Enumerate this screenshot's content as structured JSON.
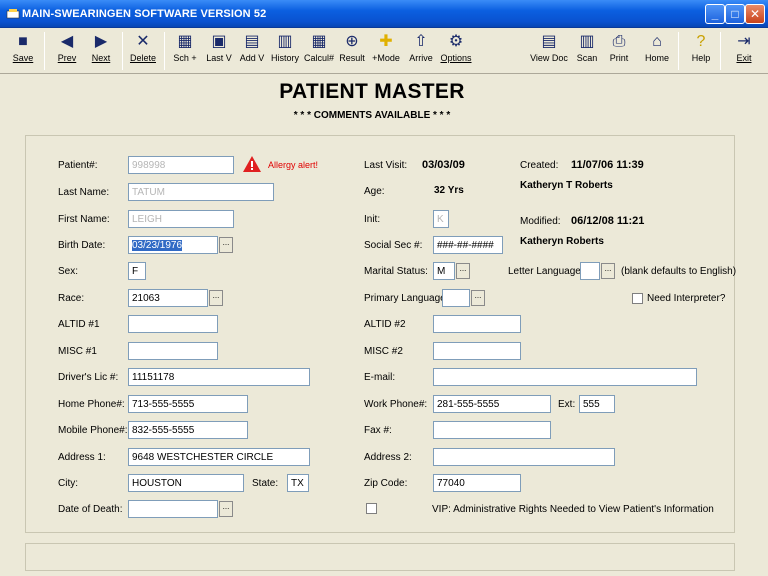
{
  "window": {
    "title": "MAIN-SWEARINGEN SOFTWARE VERSION 52",
    "minimize": "_",
    "maximize": "□",
    "close": "✕"
  },
  "toolbar": {
    "buttons": [
      {
        "label": "Save",
        "icon": "save-icon",
        "glyph": "■"
      },
      {
        "label": "Prev",
        "icon": "prev-icon",
        "glyph": "◀"
      },
      {
        "label": "Next",
        "icon": "next-icon",
        "glyph": "▶"
      },
      {
        "label": "Delete",
        "icon": "delete-icon",
        "glyph": "✕"
      },
      {
        "label": "Sch +",
        "icon": "schedule-icon",
        "glyph": "▦"
      },
      {
        "label": "Last V",
        "icon": "last-visit-icon",
        "glyph": "▣"
      },
      {
        "label": "Add V",
        "icon": "add-visit-icon",
        "glyph": "▤"
      },
      {
        "label": "History",
        "icon": "history-icon",
        "glyph": "▥"
      },
      {
        "label": "Calcul#",
        "icon": "calculator-icon",
        "glyph": "▦"
      },
      {
        "label": "Result",
        "icon": "result-icon",
        "glyph": "⊕"
      },
      {
        "label": "+Mode",
        "icon": "plus-mode-icon",
        "glyph": "✚"
      },
      {
        "label": "Arrive",
        "icon": "arrive-icon",
        "glyph": "⇧"
      },
      {
        "label": "Options",
        "icon": "options-icon",
        "glyph": "⚙"
      },
      {
        "label": "View Doc",
        "icon": "view-doc-icon",
        "glyph": "▤"
      },
      {
        "label": "Scan",
        "icon": "scan-icon",
        "glyph": "▥"
      },
      {
        "label": "Print",
        "icon": "print-icon",
        "glyph": "⎙"
      },
      {
        "label": "Home",
        "icon": "home-icon",
        "glyph": "⌂"
      },
      {
        "label": "Help",
        "icon": "help-icon",
        "glyph": "?"
      },
      {
        "label": "Exit",
        "icon": "exit-icon",
        "glyph": "⇥"
      }
    ]
  },
  "header": {
    "title": "PATIENT MASTER",
    "subtitle": "* * * COMMENTS AVAILABLE * * *"
  },
  "alert": {
    "text": "Allergy alert!",
    "color": "#e00000"
  },
  "form": {
    "patient_num": {
      "label": "Patient#:",
      "value": "998998"
    },
    "last_name": {
      "label": "Last Name:",
      "value": "TATUM"
    },
    "first_name": {
      "label": "First Name:",
      "value": "LEIGH"
    },
    "birth_date": {
      "label": "Birth Date:",
      "value": "03/23/1976"
    },
    "sex": {
      "label": "Sex:",
      "value": "F"
    },
    "race": {
      "label": "Race:",
      "value": "21063"
    },
    "altid1": {
      "label": "ALTID #1",
      "value": ""
    },
    "misc1": {
      "label": "MISC #1",
      "value": ""
    },
    "drivers_lic": {
      "label": "Driver's Lic #:",
      "value": "11151178"
    },
    "home_phone": {
      "label": "Home Phone#:",
      "value": "713-555-5555"
    },
    "mobile_phone": {
      "label": "Mobile Phone#:",
      "value": "832-555-5555"
    },
    "address1": {
      "label": "Address 1:",
      "value": "9648 WESTCHESTER CIRCLE"
    },
    "city": {
      "label": "City:",
      "value": "HOUSTON"
    },
    "state": {
      "label": "State:",
      "value": "TX"
    },
    "date_of_death": {
      "label": "Date of Death:",
      "value": ""
    },
    "last_visit": {
      "label": "Last Visit:",
      "value": "03/03/09"
    },
    "age": {
      "label": "Age:",
      "value": "32 Yrs"
    },
    "init": {
      "label": "Init:",
      "value": "K"
    },
    "ssn": {
      "label": "Social Sec #:",
      "value": "###-##-####"
    },
    "marital_status": {
      "label": "Marital Status:",
      "value": "M"
    },
    "primary_language": {
      "label": "Primary Language:",
      "value": ""
    },
    "altid2": {
      "label": "ALTID #2",
      "value": ""
    },
    "misc2": {
      "label": "MISC #2",
      "value": ""
    },
    "email": {
      "label": "E-mail:",
      "value": ""
    },
    "work_phone": {
      "label": "Work Phone#:",
      "value": "281-555-5555"
    },
    "ext": {
      "label": "Ext:",
      "value": "555"
    },
    "fax": {
      "label": "Fax #:",
      "value": ""
    },
    "address2": {
      "label": "Address 2:",
      "value": ""
    },
    "zip": {
      "label": "Zip Code:",
      "value": "77040"
    },
    "vip": {
      "label": "VIP: Administrative Rights Needed to View Patient's Information"
    },
    "created": {
      "label": "Created:",
      "value": "11/07/06 11:39",
      "by": "Katheryn T Roberts"
    },
    "modified": {
      "label": "Modified:",
      "value": "06/12/08 11:21",
      "by": "Katheryn  Roberts"
    },
    "letter_language": {
      "label": "Letter Language:",
      "value": "",
      "note": "(blank defaults to English)"
    },
    "need_interpreter": {
      "label": "Need Interpreter?"
    }
  }
}
